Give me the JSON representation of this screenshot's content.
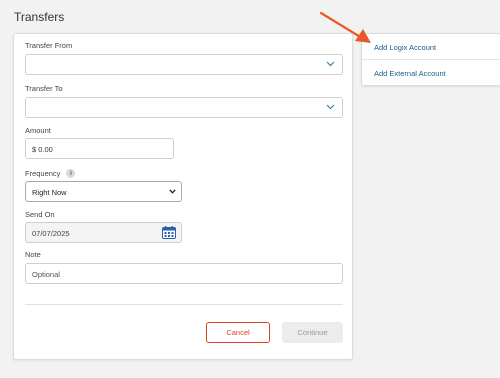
{
  "page": {
    "title": "Transfers"
  },
  "form": {
    "transfer_from_label": "Transfer From",
    "transfer_from_value": "",
    "transfer_to_label": "Transfer To",
    "transfer_to_value": "",
    "amount_label": "Amount",
    "amount_value": "$ 0.00",
    "frequency_label": "Frequency",
    "frequency_info": "i",
    "frequency_value": "Right Now",
    "send_on_label": "Send On",
    "send_on_value": "07/07/2025",
    "note_label": "Note",
    "note_placeholder": "Optional",
    "cancel_label": "Cancel",
    "continue_label": "Continue"
  },
  "side": {
    "links": [
      "Add Logix Account",
      "Add External Account"
    ]
  },
  "colors": {
    "accent": "#d9451e",
    "link": "#1a5e86",
    "arrow": "#e8592a"
  },
  "icons": {
    "chevron": "chevron-down-icon",
    "calendar": "calendar-icon",
    "info": "info-icon",
    "arrow": "annotation-arrow-icon"
  }
}
